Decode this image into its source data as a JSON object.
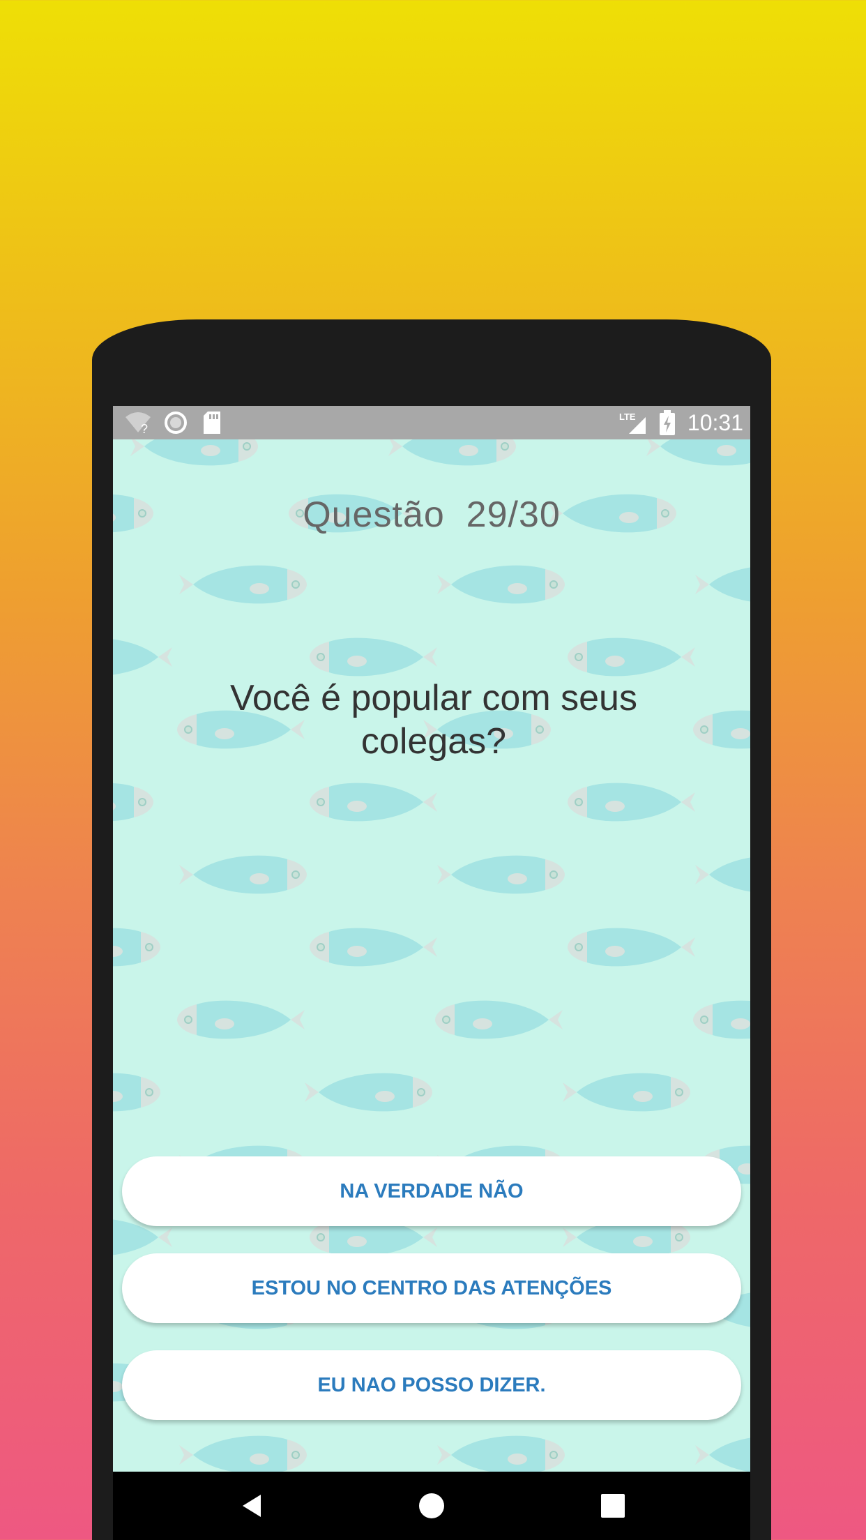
{
  "status_bar": {
    "time": "10:31",
    "icons": [
      "wifi-unknown-icon",
      "sync-circle-icon",
      "sd-card-icon",
      "lte-signal-icon",
      "battery-charging-icon"
    ],
    "lte_label": "LTE"
  },
  "quiz": {
    "counter_label": "Questão",
    "counter_value": "29/30",
    "question": "Você é popular com seus colegas?",
    "answers": [
      {
        "label": "NA VERDADE NÃO"
      },
      {
        "label": "ESTOU NO CENTRO DAS ATENÇÕES"
      },
      {
        "label": "EU NAO POSSO DIZER."
      }
    ]
  },
  "navigation": {
    "buttons": [
      "back-icon",
      "home-icon",
      "recents-icon"
    ]
  },
  "colors": {
    "background_top": "#eedf06",
    "background_bottom": "#ee5882",
    "app_background": "#c9f5ea",
    "fish_body": "#a5e4e3",
    "fish_head": "#d6e3df",
    "answer_text": "#2b7bbd",
    "counter_text": "#666666",
    "question_text": "#333333"
  }
}
